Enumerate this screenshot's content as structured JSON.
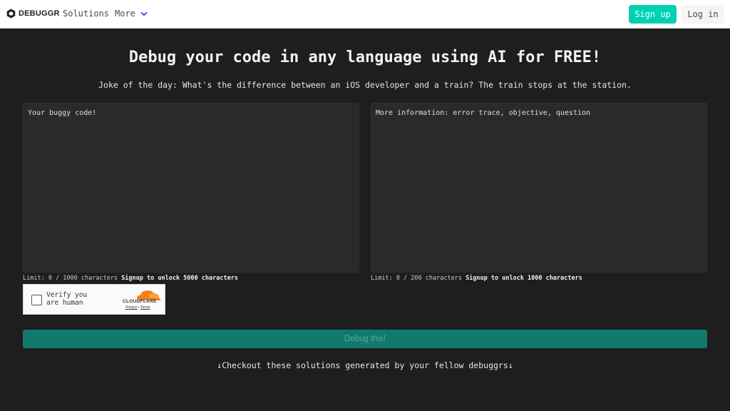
{
  "navbar": {
    "brand": "DEBUGGR",
    "links": {
      "solutions": "Solutions",
      "more": "More"
    },
    "signup_label": "Sign up",
    "login_label": "Log in"
  },
  "hero": {
    "title": "Debug your code in any language using AI for FREE!",
    "joke": "Joke of the day: What's the difference between an iOS developer and a train? The train stops at the station."
  },
  "code_input": {
    "placeholder": "Your buggy code!",
    "limit_text": "Limit: 0 / 1000 characters",
    "upsell": "Signup to unlock 5000 characters"
  },
  "info_input": {
    "placeholder": "More information: error trace, objective, question",
    "limit_text": "Limit: 0 / 200 characters",
    "upsell": "Signup to unlock 1000 characters"
  },
  "captcha": {
    "label": "Verify you are human",
    "brand": "CLOUDFLARE",
    "privacy": "Privacy",
    "separator": "•",
    "terms": "Terms"
  },
  "debug_button": "Debug this!",
  "checkout_text": "↓Checkout these solutions generated by your fellow debuggrs↓",
  "colors": {
    "accent": "#00d1b2",
    "debug_button_bg": "#127a6c",
    "page_bg": "#1e1e1e",
    "textarea_bg": "#2a2a2a"
  },
  "icons": [
    "hexagon-logo-icon",
    "chevron-down-icon",
    "cloudflare-cloud-icon"
  ]
}
